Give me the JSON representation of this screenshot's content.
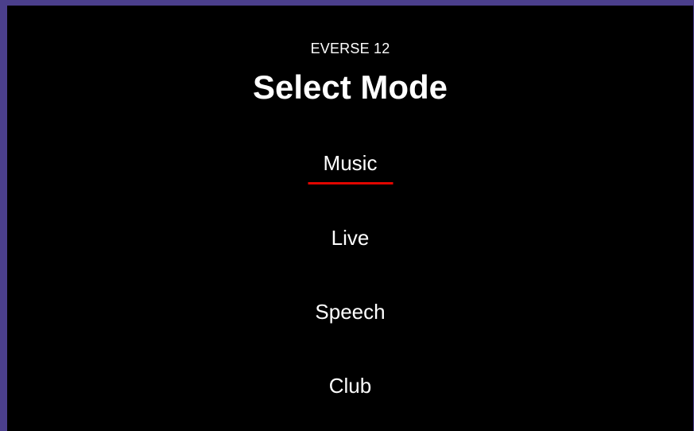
{
  "device": {
    "model": "EVERSE 12"
  },
  "screen": {
    "title": "Select Mode"
  },
  "modes": [
    {
      "label": "Music",
      "selected": true
    },
    {
      "label": "Live",
      "selected": false
    },
    {
      "label": "Speech",
      "selected": false
    },
    {
      "label": "Club",
      "selected": false
    }
  ],
  "colors": {
    "background": "#000000",
    "text": "#ffffff",
    "selection_accent": "#e10600",
    "frame_border": "#4b3f8c"
  }
}
